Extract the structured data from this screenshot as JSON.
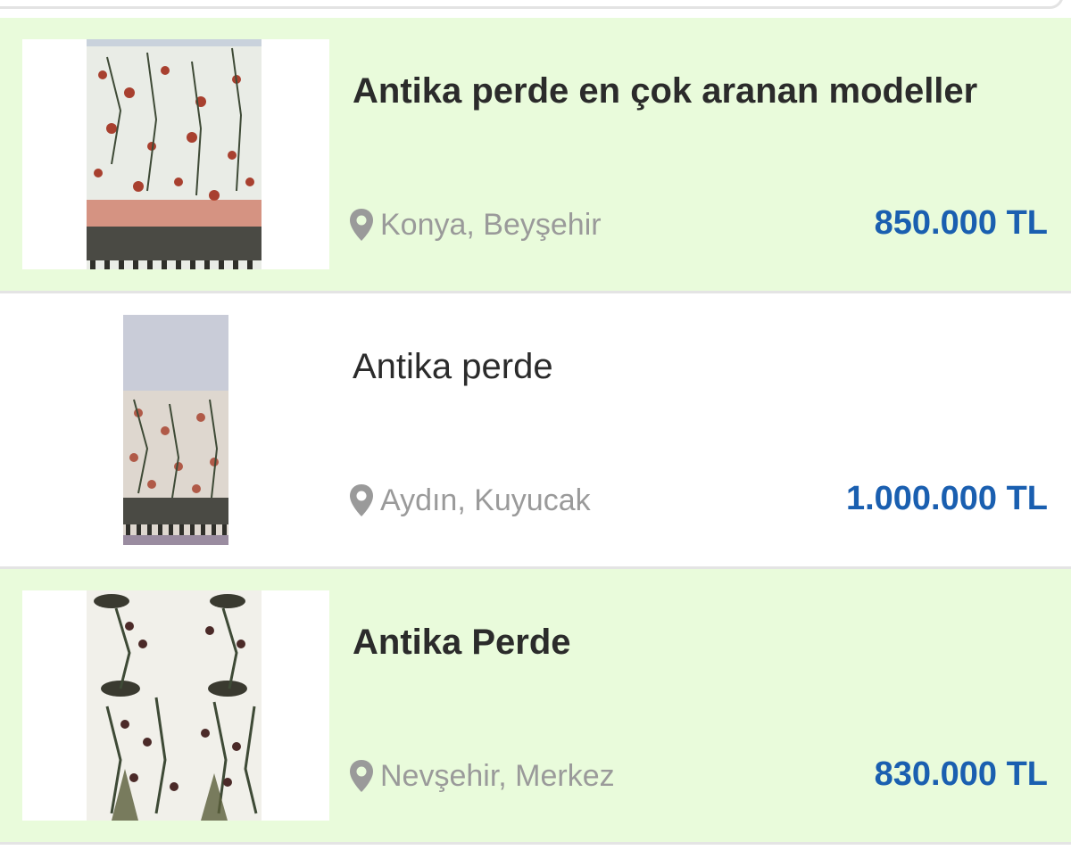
{
  "colors": {
    "featured_bg": "#e9fbdb",
    "price": "#1a5fb0",
    "location_text": "#9a9a9a",
    "title_text": "#2b2b2b",
    "divider": "#e4e4e4"
  },
  "listings": [
    {
      "title": "Antika perde en çok aranan modeller",
      "location": "Konya, Beyşehir",
      "price": "850.000 TL",
      "featured": true,
      "icon": "location-pin-icon"
    },
    {
      "title": "Antika perde",
      "location": "Aydın, Kuyucak",
      "price": "1.000.000 TL",
      "featured": false,
      "icon": "location-pin-icon"
    },
    {
      "title": "Antika Perde",
      "location": "Nevşehir, Merkez",
      "price": "830.000 TL",
      "featured": true,
      "icon": "location-pin-icon"
    }
  ]
}
